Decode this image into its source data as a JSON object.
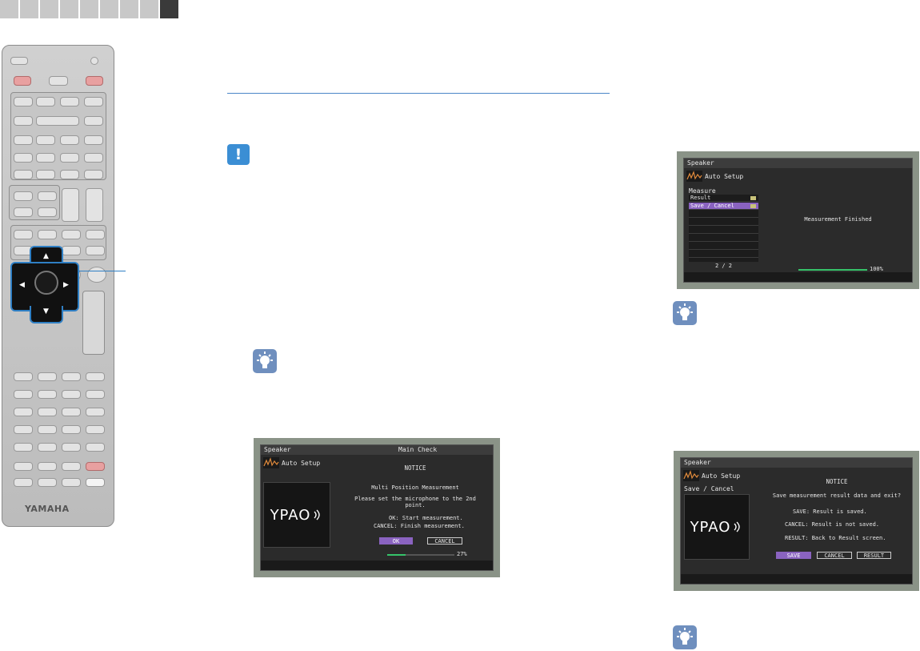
{
  "brand": {
    "logo_text": "YAMAHA"
  },
  "screen_main_check": {
    "header_left": "Speaker",
    "header_right": "Main Check",
    "auto_setup_label": "Auto Setup",
    "logo_text": "YPAO",
    "notice_title": "NOTICE",
    "heading": "Multi Position Measurement",
    "message_line1": "Please set the microphone to the 2nd",
    "message_line2": "point.",
    "ok_desc": "OK:  Start measurement.",
    "cancel_desc": "CANCEL:  Finish measurement.",
    "ok_button": "OK",
    "cancel_button": "CANCEL",
    "progress_text": "27%",
    "progress": 0.27
  },
  "screen_measure_finished": {
    "header": "Speaker",
    "auto_setup_label": "Auto Setup",
    "section_label": "Measure",
    "menu_items": [
      "Result",
      "Save / Cancel"
    ],
    "selected_index": 1,
    "page_indicator": "2 / 2",
    "message": "Measurement Finished",
    "progress_text": "100%",
    "progress": 1.0
  },
  "screen_save_cancel": {
    "header": "Speaker",
    "auto_setup_label": "Auto Setup",
    "section_label": "Save / Cancel",
    "logo_text": "YPAO",
    "notice_title": "NOTICE",
    "question": "Save measurement result data and exit?",
    "save_desc": "SAVE:  Result is saved.",
    "cancel_desc": "CANCEL:  Result is not saved.",
    "result_desc": "RESULT:  Back to Result screen.",
    "save_button": "SAVE",
    "cancel_button": "CANCEL",
    "result_button": "RESULT"
  }
}
